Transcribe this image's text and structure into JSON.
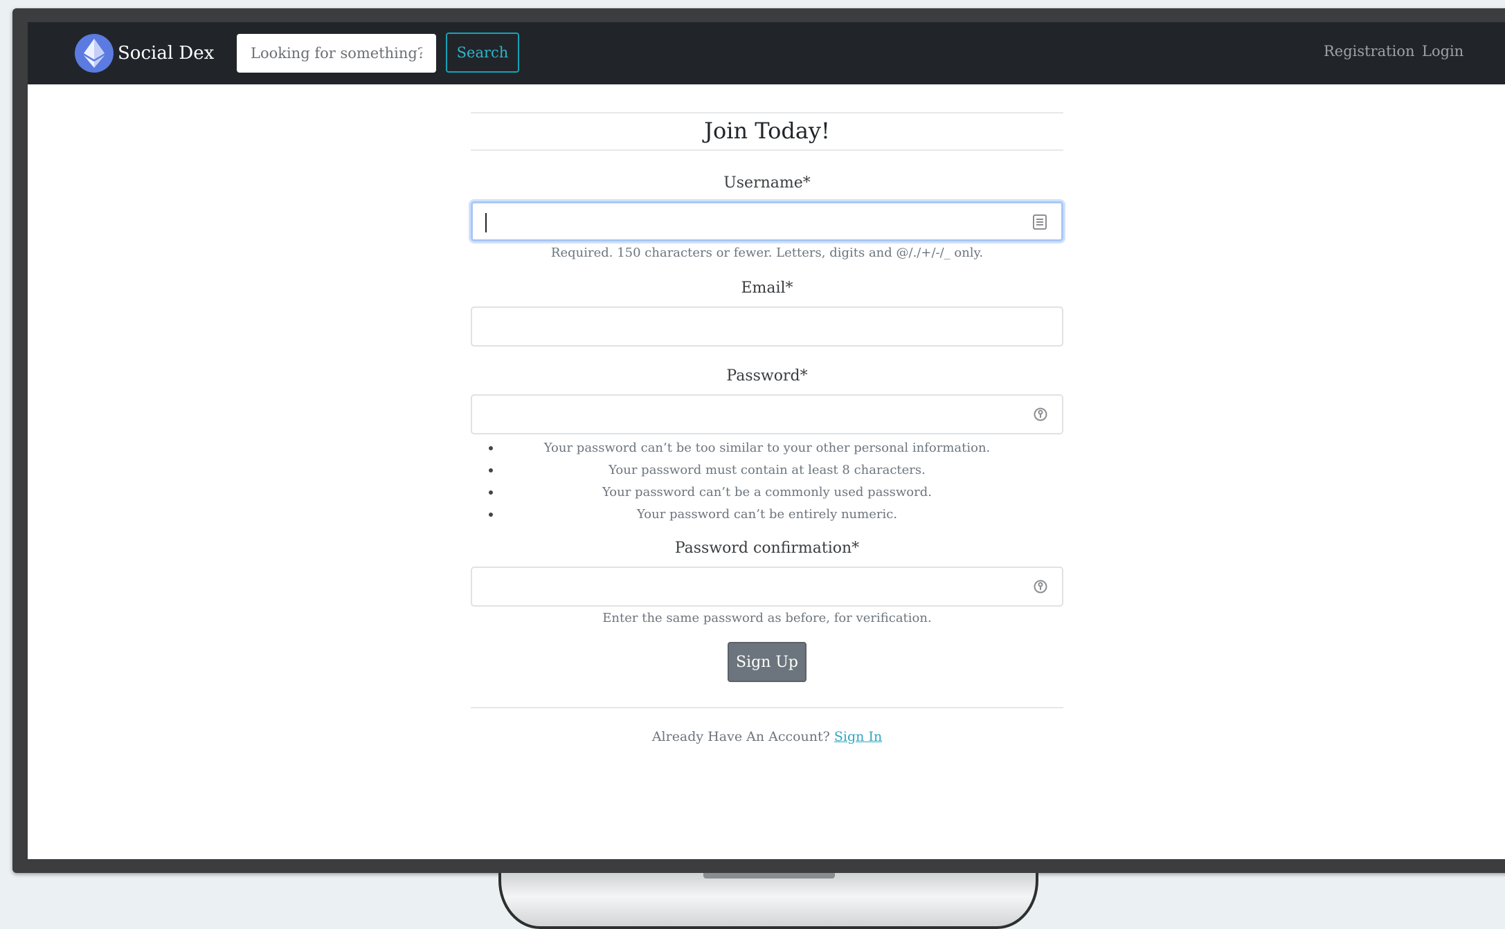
{
  "navbar": {
    "brand": "Social Dex",
    "search_placeholder": "Looking for something?",
    "search_button": "Search",
    "links": [
      {
        "label": "Registration"
      },
      {
        "label": "Login"
      }
    ]
  },
  "form": {
    "title": "Join Today!",
    "username": {
      "label": "Username*",
      "help": "Required. 150 characters or fewer. Letters, digits and @/./+/-/_ only."
    },
    "email": {
      "label": "Email*"
    },
    "password": {
      "label": "Password*",
      "rules": [
        "Your password can’t be too similar to your other personal information.",
        "Your password must contain at least 8 characters.",
        "Your password can’t be a commonly used password.",
        "Your password can’t be entirely numeric."
      ]
    },
    "password_confirmation": {
      "label": "Password confirmation*",
      "help": "Enter the same password as before, for verification."
    },
    "submit": "Sign Up",
    "footer_text": "Already Have An Account?",
    "footer_link": "Sign In"
  },
  "icons": {
    "username_field": "autofill-card-icon",
    "password_field": "key-icon",
    "password_confirmation_field": "key-icon"
  },
  "colors": {
    "navbar_bg": "#212529",
    "search_accent": "#17a2b8",
    "button_secondary": "#6c757d",
    "link": "#2fa5bd",
    "focus_ring": "#a9c7f7"
  }
}
